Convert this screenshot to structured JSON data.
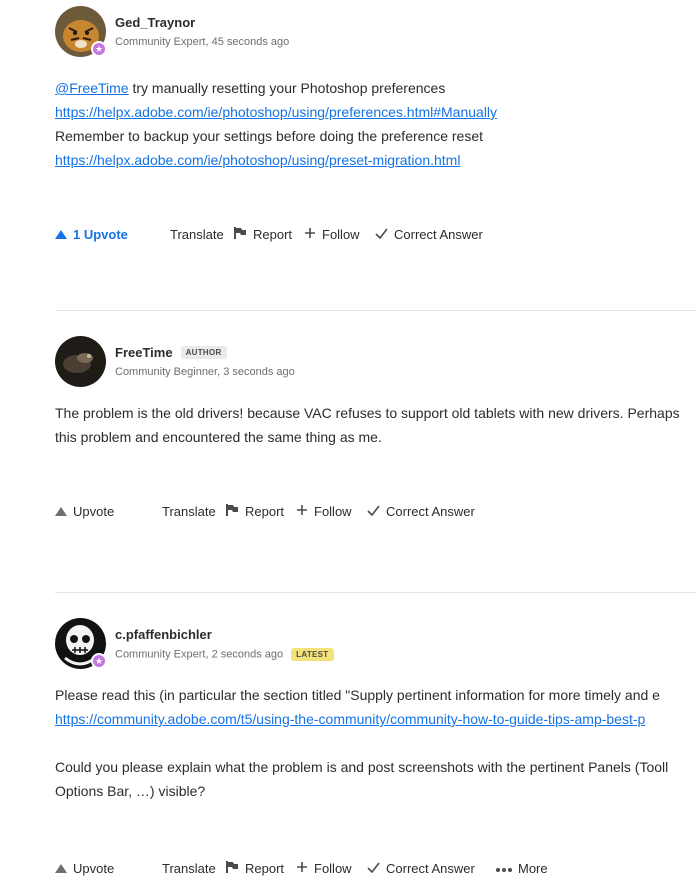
{
  "posts": [
    {
      "username": "Ged_Traynor",
      "role": "Community Expert",
      "time": "45 seconds ago",
      "mention": "@FreeTime",
      "line1_text": " try manually resetting your Photoshop preferences",
      "link1": "https://helpx.adobe.com/ie/photoshop/using/preferences.html#Manually",
      "line3": "Remember to backup your settings before doing the preference reset",
      "link2": "https://helpx.adobe.com/ie/photoshop/using/preset-migration.html",
      "actions": {
        "upvote": "1 Upvote",
        "translate": "Translate",
        "report": "Report",
        "follow": "Follow",
        "correct": "Correct Answer"
      }
    },
    {
      "username": "FreeTime",
      "tag": "AUTHOR",
      "role": "Community Beginner",
      "time": "3 seconds ago",
      "line1": "The problem is the old drivers! because VAC refuses to support old tablets with new drivers. Perhaps",
      "line2": "this problem and encountered the same thing as me.",
      "actions": {
        "upvote": "Upvote",
        "translate": "Translate",
        "report": "Report",
        "follow": "Follow",
        "correct": "Correct Answer"
      }
    },
    {
      "username": "c.pfaffenbichler",
      "tag": "LATEST",
      "role": "Community Expert",
      "time": "2 seconds ago",
      "line1": "Please read this (in particular the section titled \"Supply pertinent information for more timely and e",
      "link1": "https://community.adobe.com/t5/using-the-community/community-how-to-guide-tips-amp-best-p",
      "line3": "Could you please explain what the problem is and post screenshots with the pertinent Panels (Tooll",
      "line4": "Options Bar, …) visible?",
      "actions": {
        "upvote": "Upvote",
        "translate": "Translate",
        "report": "Report",
        "follow": "Follow",
        "correct": "Correct Answer",
        "more": "More"
      }
    }
  ],
  "colors": {
    "link": "#1473e6",
    "expert_badge": "#c376e0",
    "latest_tag": "#f3e27a"
  }
}
